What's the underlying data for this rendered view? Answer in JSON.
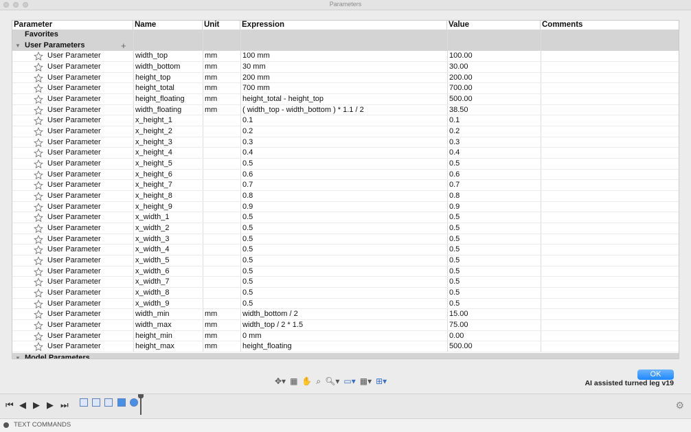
{
  "window": {
    "title": "Parameters"
  },
  "columns": {
    "parameter": "Parameter",
    "name": "Name",
    "unit": "Unit",
    "expression": "Expression",
    "value": "Value",
    "comments": "Comments"
  },
  "groups": {
    "favorites": "Favorites",
    "user_parameters": "User Parameters",
    "model_parameters": "Model Parameters"
  },
  "rows": [
    {
      "type": "User Parameter",
      "name": "width_top",
      "unit": "mm",
      "expression": "100 mm",
      "value": "100.00"
    },
    {
      "type": "User Parameter",
      "name": "width_bottom",
      "unit": "mm",
      "expression": "30 mm",
      "value": "30.00"
    },
    {
      "type": "User Parameter",
      "name": "height_top",
      "unit": "mm",
      "expression": "200 mm",
      "value": "200.00"
    },
    {
      "type": "User Parameter",
      "name": "height_total",
      "unit": "mm",
      "expression": "700 mm",
      "value": "700.00"
    },
    {
      "type": "User Parameter",
      "name": "height_floating",
      "unit": "mm",
      "expression": "height_total - height_top",
      "value": "500.00"
    },
    {
      "type": "User Parameter",
      "name": "width_floating",
      "unit": "mm",
      "expression": "( width_top - width_bottom ) * 1.1 / 2",
      "value": "38.50"
    },
    {
      "type": "User Parameter",
      "name": "x_height_1",
      "unit": "",
      "expression": "0.1",
      "value": "0.1"
    },
    {
      "type": "User Parameter",
      "name": "x_height_2",
      "unit": "",
      "expression": "0.2",
      "value": "0.2"
    },
    {
      "type": "User Parameter",
      "name": "x_height_3",
      "unit": "",
      "expression": "0.3",
      "value": "0.3"
    },
    {
      "type": "User Parameter",
      "name": "x_height_4",
      "unit": "",
      "expression": "0.4",
      "value": "0.4"
    },
    {
      "type": "User Parameter",
      "name": "x_height_5",
      "unit": "",
      "expression": "0.5",
      "value": "0.5"
    },
    {
      "type": "User Parameter",
      "name": "x_height_6",
      "unit": "",
      "expression": "0.6",
      "value": "0.6"
    },
    {
      "type": "User Parameter",
      "name": "x_height_7",
      "unit": "",
      "expression": "0.7",
      "value": "0.7"
    },
    {
      "type": "User Parameter",
      "name": "x_height_8",
      "unit": "",
      "expression": "0.8",
      "value": "0.8"
    },
    {
      "type": "User Parameter",
      "name": "x_height_9",
      "unit": "",
      "expression": "0.9",
      "value": "0.9"
    },
    {
      "type": "User Parameter",
      "name": "x_width_1",
      "unit": "",
      "expression": "0.5",
      "value": "0.5"
    },
    {
      "type": "User Parameter",
      "name": "x_width_2",
      "unit": "",
      "expression": "0.5",
      "value": "0.5"
    },
    {
      "type": "User Parameter",
      "name": "x_width_3",
      "unit": "",
      "expression": "0.5",
      "value": "0.5"
    },
    {
      "type": "User Parameter",
      "name": "x_width_4",
      "unit": "",
      "expression": "0.5",
      "value": "0.5"
    },
    {
      "type": "User Parameter",
      "name": "x_width_5",
      "unit": "",
      "expression": "0.5",
      "value": "0.5"
    },
    {
      "type": "User Parameter",
      "name": "x_width_6",
      "unit": "",
      "expression": "0.5",
      "value": "0.5"
    },
    {
      "type": "User Parameter",
      "name": "x_width_7",
      "unit": "",
      "expression": "0.5",
      "value": "0.5"
    },
    {
      "type": "User Parameter",
      "name": "x_width_8",
      "unit": "",
      "expression": "0.5",
      "value": "0.5"
    },
    {
      "type": "User Parameter",
      "name": "x_width_9",
      "unit": "",
      "expression": "0.5",
      "value": "0.5"
    },
    {
      "type": "User Parameter",
      "name": "width_min",
      "unit": "mm",
      "expression": "width_bottom / 2",
      "value": "15.00"
    },
    {
      "type": "User Parameter",
      "name": "width_max",
      "unit": "mm",
      "expression": "width_top / 2 * 1.5",
      "value": "75.00"
    },
    {
      "type": "User Parameter",
      "name": "height_min",
      "unit": "mm",
      "expression": "0 mm",
      "value": "0.00"
    },
    {
      "type": "User Parameter",
      "name": "height_max",
      "unit": "mm",
      "expression": "height_floating",
      "value": "500.00"
    }
  ],
  "dialog": {
    "ok_label": "OK",
    "document_label": "AI assisted turned leg v19"
  },
  "command_bar": {
    "label": "TEXT COMMANDS"
  },
  "icons": {
    "star": "star-outline-icon",
    "add": "plus-icon",
    "expand": "triangle-down-icon",
    "settings": "gear-icon"
  }
}
